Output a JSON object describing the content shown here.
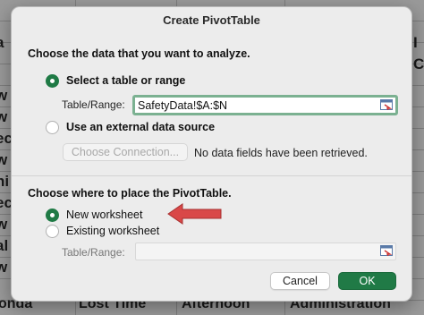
{
  "background": {
    "left_fragments": [
      "w",
      "w",
      "ec",
      "w",
      "hi",
      "ec",
      "w",
      "al",
      "w"
    ],
    "top_left_fragment": "a",
    "right_fragments": [
      "I",
      "C"
    ],
    "bottom_texts": [
      "onda",
      "Lost Time",
      "Afternoon",
      "Administration"
    ]
  },
  "dialog": {
    "title": "Create PivotTable",
    "analyze_heading": "Choose the data that you want to analyze.",
    "option_table_range": "Select a table or range",
    "table_range_label": "Table/Range:",
    "table_range_value": "SafetyData!$A:$N",
    "option_external": "Use an external data source",
    "choose_connection_label": "Choose Connection...",
    "no_fields_text": "No data fields have been retrieved.",
    "place_heading": "Choose where to place the PivotTable.",
    "option_new_worksheet": "New worksheet",
    "option_existing_worksheet": "Existing worksheet",
    "existing_range_label": "Table/Range:",
    "existing_range_value": "",
    "cancel_label": "Cancel",
    "ok_label": "OK"
  },
  "annotation": {
    "arrow_color": "#d94848",
    "arrow_icon": "left-arrow-icon"
  },
  "colors": {
    "accent": "#207a46",
    "focus_ring": "#7bb191"
  }
}
